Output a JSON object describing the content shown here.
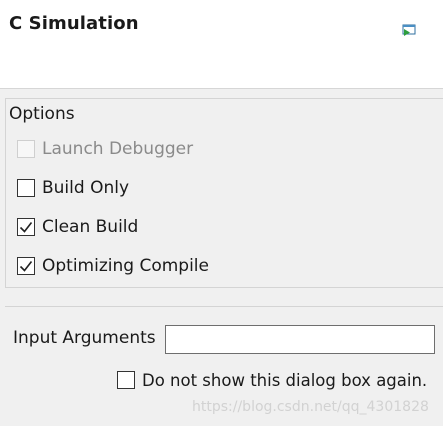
{
  "dialog": {
    "title": "C Simulation",
    "header_icon": "sim-run-icon"
  },
  "options": {
    "legend": "Options",
    "items": [
      {
        "label": "Launch Debugger",
        "checked": false,
        "enabled": false
      },
      {
        "label": "Build Only",
        "checked": false,
        "enabled": true
      },
      {
        "label": "Clean Build",
        "checked": true,
        "enabled": true
      },
      {
        "label": "Optimizing Compile",
        "checked": true,
        "enabled": true
      }
    ]
  },
  "arguments": {
    "label": "Input Arguments",
    "value": ""
  },
  "dont_show": {
    "label": "Do not show this dialog box again.",
    "checked": false
  },
  "watermark": "https://blog.csdn.net/qq_4301828"
}
